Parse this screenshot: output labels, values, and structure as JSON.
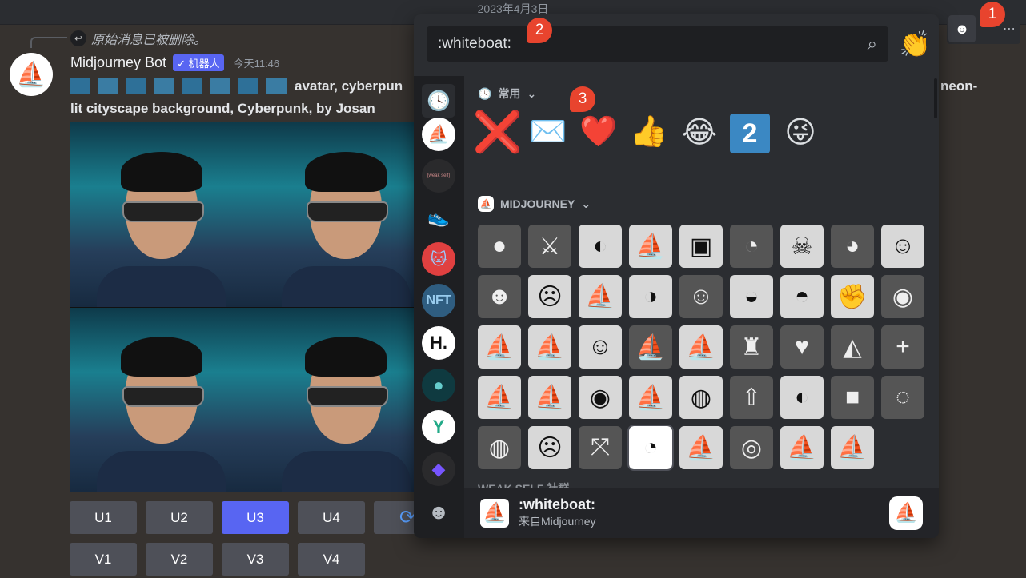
{
  "header": {
    "date": "2023年4月3日"
  },
  "message": {
    "reply_text": "原始消息已被删除。",
    "author": "Midjourney Bot",
    "bot_tag": "✓ 机器人",
    "timestamp": "今天11:46",
    "line1": "avatar, cyberpun",
    "line1_end": "neon-",
    "line2": "lit cityscape background, Cyberpunk, by Josan"
  },
  "buttons": {
    "row1": [
      "U1",
      "U2",
      "U3",
      "U4"
    ],
    "row2": [
      "V1",
      "V2",
      "V3",
      "V4"
    ],
    "active": "U3",
    "refresh_icon": "refresh-icon"
  },
  "emoji_picker": {
    "search_value": ":whiteboat:",
    "search_icon": "search-icon",
    "sections": {
      "frequent": "常用",
      "midjourney": "MIDJOURNEY",
      "weak_self": "WEAK SELF 社群"
    },
    "frequent_emojis": [
      "❌",
      "✉️",
      "❤️",
      "👍",
      "😂",
      "2",
      "😜"
    ],
    "sidebar_servers": [
      "[weak self]",
      "H.",
      "NFT"
    ],
    "footer": {
      "name": ":whiteboat:",
      "source": "来自Midjourney"
    }
  },
  "annotations": [
    "1",
    "2",
    "3"
  ],
  "colors": {
    "accent": "#5865f2",
    "badge": "#e8442e"
  }
}
